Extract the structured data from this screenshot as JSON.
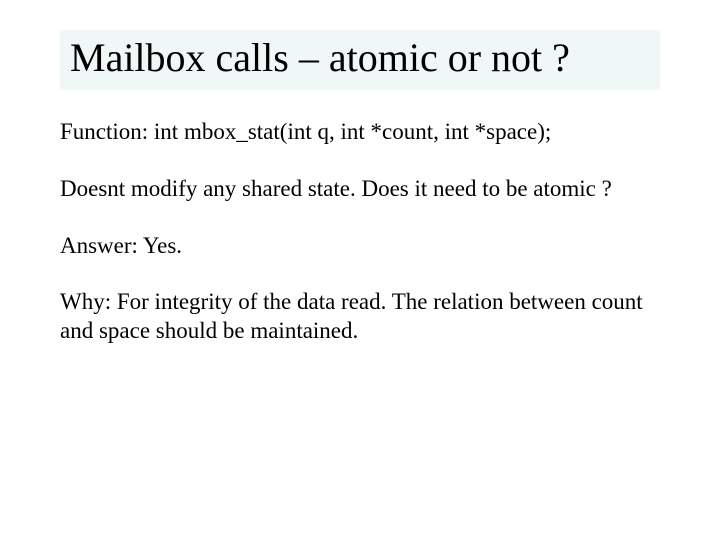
{
  "slide": {
    "title": "Mailbox calls – atomic or not ?",
    "paragraphs": {
      "p1": "Function: int  mbox_stat(int q, int *count, int *space);",
      "p2": "Doesnt modify any shared state. Does it need to be atomic ?",
      "p3": "Answer: Yes.",
      "p4": "Why: For integrity of the data read. The relation between count and space should be maintained."
    }
  }
}
